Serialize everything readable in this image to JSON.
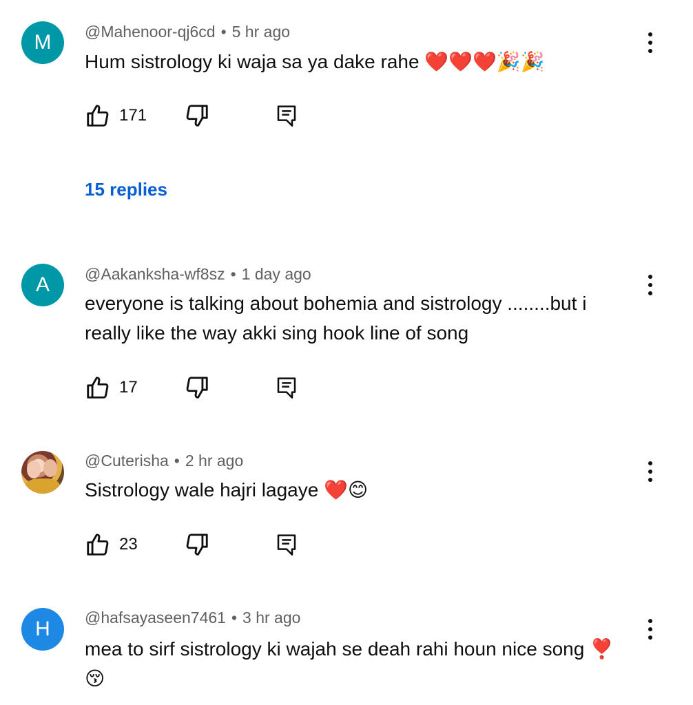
{
  "comments": [
    {
      "avatar_letter": "M",
      "avatar_color": "#0097a7",
      "author": "@Mahenoor-qj6cd",
      "separator": "•",
      "time": "5 hr ago",
      "text": "Hum sistrology ki waja sa ya dake rahe ❤️❤️❤️🎉🎉",
      "likes": "171",
      "replies_label": "15 replies"
    },
    {
      "avatar_letter": "A",
      "avatar_color": "#0097a7",
      "author": "@Aakanksha-wf8sz",
      "separator": "•",
      "time": "1 day ago",
      "text": "everyone is talking about bohemia and sistrology ........but i really like the way akki sing hook line of song",
      "likes": "17"
    },
    {
      "avatar_type": "photo",
      "author": "@Cuterisha",
      "separator": "•",
      "time": "2 hr ago",
      "text": "Sistrology wale hajri lagaye ❤️😊",
      "likes": "23"
    },
    {
      "avatar_letter": "H",
      "avatar_color": "#1e88e5",
      "author": "@hafsayaseen7461",
      "separator": "•",
      "time": "3 hr ago",
      "text": "mea to sirf sistrology ki wajah se deah rahi houn nice song ❣️ 😚"
    }
  ],
  "icons": {
    "like": "thumb-up-icon",
    "dislike": "thumb-down-icon",
    "reply": "reply-comment-icon",
    "menu": "more-vert-icon"
  },
  "colors": {
    "link_blue": "#065fd4",
    "meta_gray": "#606060"
  }
}
